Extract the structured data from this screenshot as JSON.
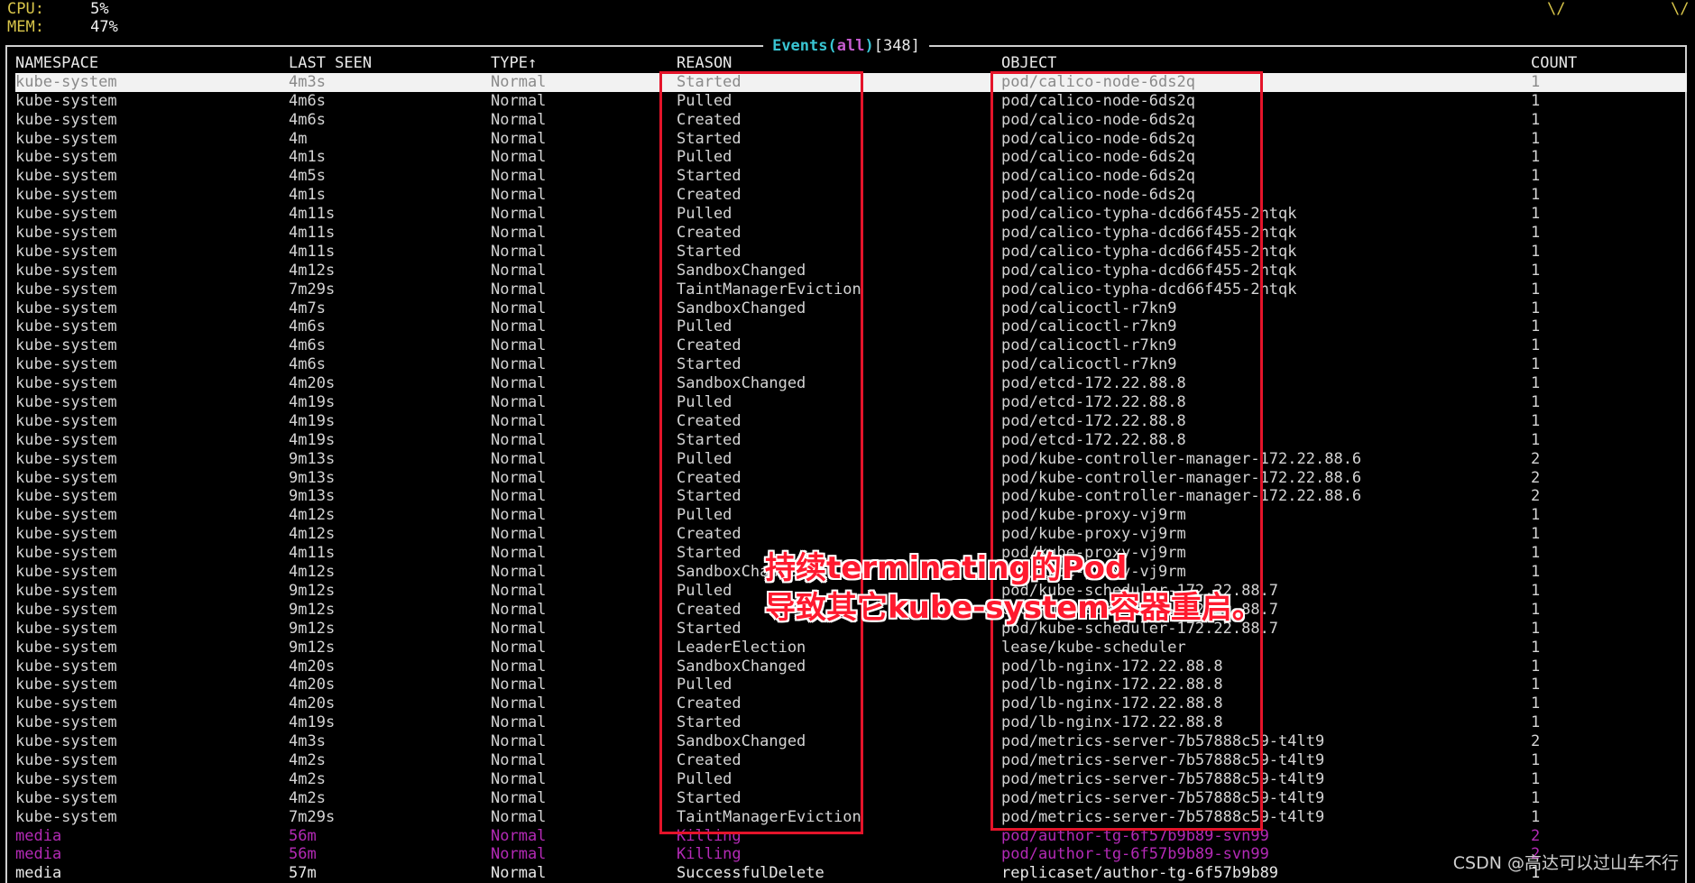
{
  "stats": {
    "cpu_label": "CPU:",
    "cpu_value": "5%",
    "mem_label": "MEM:",
    "mem_value": "47%",
    "right_markers": [
      "\\/",
      "\\/"
    ]
  },
  "panel": {
    "title_name": "Events",
    "title_paren_open": "(",
    "title_filter": "all",
    "title_paren_close": ")",
    "title_count": "[348]"
  },
  "columns": {
    "namespace": "NAMESPACE",
    "last_seen": "LAST SEEN",
    "type": "TYPE↑",
    "reason": "REASON",
    "object": "OBJECT",
    "count": "COUNT"
  },
  "rows": [
    {
      "ns": "kube-system",
      "ls": "4m3s",
      "type": "Normal",
      "reason": "Started",
      "object": "pod/calico-node-6ds2q",
      "count": "1"
    },
    {
      "ns": "kube-system",
      "ls": "4m6s",
      "type": "Normal",
      "reason": "Pulled",
      "object": "pod/calico-node-6ds2q",
      "count": "1"
    },
    {
      "ns": "kube-system",
      "ls": "4m6s",
      "type": "Normal",
      "reason": "Created",
      "object": "pod/calico-node-6ds2q",
      "count": "1"
    },
    {
      "ns": "kube-system",
      "ls": "4m",
      "type": "Normal",
      "reason": "Started",
      "object": "pod/calico-node-6ds2q",
      "count": "1"
    },
    {
      "ns": "kube-system",
      "ls": "4m1s",
      "type": "Normal",
      "reason": "Pulled",
      "object": "pod/calico-node-6ds2q",
      "count": "1"
    },
    {
      "ns": "kube-system",
      "ls": "4m5s",
      "type": "Normal",
      "reason": "Started",
      "object": "pod/calico-node-6ds2q",
      "count": "1"
    },
    {
      "ns": "kube-system",
      "ls": "4m1s",
      "type": "Normal",
      "reason": "Created",
      "object": "pod/calico-node-6ds2q",
      "count": "1"
    },
    {
      "ns": "kube-system",
      "ls": "4m11s",
      "type": "Normal",
      "reason": "Pulled",
      "object": "pod/calico-typha-dcd66f455-2htqk",
      "count": "1"
    },
    {
      "ns": "kube-system",
      "ls": "4m11s",
      "type": "Normal",
      "reason": "Created",
      "object": "pod/calico-typha-dcd66f455-2htqk",
      "count": "1"
    },
    {
      "ns": "kube-system",
      "ls": "4m11s",
      "type": "Normal",
      "reason": "Started",
      "object": "pod/calico-typha-dcd66f455-2htqk",
      "count": "1"
    },
    {
      "ns": "kube-system",
      "ls": "4m12s",
      "type": "Normal",
      "reason": "SandboxChanged",
      "object": "pod/calico-typha-dcd66f455-2htqk",
      "count": "1"
    },
    {
      "ns": "kube-system",
      "ls": "7m29s",
      "type": "Normal",
      "reason": "TaintManagerEviction",
      "object": "pod/calico-typha-dcd66f455-2htqk",
      "count": "1"
    },
    {
      "ns": "kube-system",
      "ls": "4m7s",
      "type": "Normal",
      "reason": "SandboxChanged",
      "object": "pod/calicoctl-r7kn9",
      "count": "1"
    },
    {
      "ns": "kube-system",
      "ls": "4m6s",
      "type": "Normal",
      "reason": "Pulled",
      "object": "pod/calicoctl-r7kn9",
      "count": "1"
    },
    {
      "ns": "kube-system",
      "ls": "4m6s",
      "type": "Normal",
      "reason": "Created",
      "object": "pod/calicoctl-r7kn9",
      "count": "1"
    },
    {
      "ns": "kube-system",
      "ls": "4m6s",
      "type": "Normal",
      "reason": "Started",
      "object": "pod/calicoctl-r7kn9",
      "count": "1"
    },
    {
      "ns": "kube-system",
      "ls": "4m20s",
      "type": "Normal",
      "reason": "SandboxChanged",
      "object": "pod/etcd-172.22.88.8",
      "count": "1"
    },
    {
      "ns": "kube-system",
      "ls": "4m19s",
      "type": "Normal",
      "reason": "Pulled",
      "object": "pod/etcd-172.22.88.8",
      "count": "1"
    },
    {
      "ns": "kube-system",
      "ls": "4m19s",
      "type": "Normal",
      "reason": "Created",
      "object": "pod/etcd-172.22.88.8",
      "count": "1"
    },
    {
      "ns": "kube-system",
      "ls": "4m19s",
      "type": "Normal",
      "reason": "Started",
      "object": "pod/etcd-172.22.88.8",
      "count": "1"
    },
    {
      "ns": "kube-system",
      "ls": "9m13s",
      "type": "Normal",
      "reason": "Pulled",
      "object": "pod/kube-controller-manager-172.22.88.6",
      "count": "2"
    },
    {
      "ns": "kube-system",
      "ls": "9m13s",
      "type": "Normal",
      "reason": "Created",
      "object": "pod/kube-controller-manager-172.22.88.6",
      "count": "2"
    },
    {
      "ns": "kube-system",
      "ls": "9m13s",
      "type": "Normal",
      "reason": "Started",
      "object": "pod/kube-controller-manager-172.22.88.6",
      "count": "2"
    },
    {
      "ns": "kube-system",
      "ls": "4m12s",
      "type": "Normal",
      "reason": "Pulled",
      "object": "pod/kube-proxy-vj9rm",
      "count": "1"
    },
    {
      "ns": "kube-system",
      "ls": "4m12s",
      "type": "Normal",
      "reason": "Created",
      "object": "pod/kube-proxy-vj9rm",
      "count": "1"
    },
    {
      "ns": "kube-system",
      "ls": "4m11s",
      "type": "Normal",
      "reason": "Started",
      "object": "pod/kube-proxy-vj9rm",
      "count": "1"
    },
    {
      "ns": "kube-system",
      "ls": "4m12s",
      "type": "Normal",
      "reason": "SandboxChanged",
      "object": "pod/kube-proxy-vj9rm",
      "count": "1"
    },
    {
      "ns": "kube-system",
      "ls": "9m12s",
      "type": "Normal",
      "reason": "Pulled",
      "object": "pod/kube-scheduler-172.22.88.7",
      "count": "1"
    },
    {
      "ns": "kube-system",
      "ls": "9m12s",
      "type": "Normal",
      "reason": "Created",
      "object": "pod/kube-scheduler-172.22.88.7",
      "count": "1"
    },
    {
      "ns": "kube-system",
      "ls": "9m12s",
      "type": "Normal",
      "reason": "Started",
      "object": "pod/kube-scheduler-172.22.88.7",
      "count": "1"
    },
    {
      "ns": "kube-system",
      "ls": "9m12s",
      "type": "Normal",
      "reason": "LeaderElection",
      "object": "lease/kube-scheduler",
      "count": "1"
    },
    {
      "ns": "kube-system",
      "ls": "4m20s",
      "type": "Normal",
      "reason": "SandboxChanged",
      "object": "pod/lb-nginx-172.22.88.8",
      "count": "1"
    },
    {
      "ns": "kube-system",
      "ls": "4m20s",
      "type": "Normal",
      "reason": "Pulled",
      "object": "pod/lb-nginx-172.22.88.8",
      "count": "1"
    },
    {
      "ns": "kube-system",
      "ls": "4m20s",
      "type": "Normal",
      "reason": "Created",
      "object": "pod/lb-nginx-172.22.88.8",
      "count": "1"
    },
    {
      "ns": "kube-system",
      "ls": "4m19s",
      "type": "Normal",
      "reason": "Started",
      "object": "pod/lb-nginx-172.22.88.8",
      "count": "1"
    },
    {
      "ns": "kube-system",
      "ls": "4m3s",
      "type": "Normal",
      "reason": "SandboxChanged",
      "object": "pod/metrics-server-7b57888c59-t4lt9",
      "count": "2"
    },
    {
      "ns": "kube-system",
      "ls": "4m2s",
      "type": "Normal",
      "reason": "Created",
      "object": "pod/metrics-server-7b57888c59-t4lt9",
      "count": "1"
    },
    {
      "ns": "kube-system",
      "ls": "4m2s",
      "type": "Normal",
      "reason": "Pulled",
      "object": "pod/metrics-server-7b57888c59-t4lt9",
      "count": "1"
    },
    {
      "ns": "kube-system",
      "ls": "4m2s",
      "type": "Normal",
      "reason": "Started",
      "object": "pod/metrics-server-7b57888c59-t4lt9",
      "count": "1"
    },
    {
      "ns": "kube-system",
      "ls": "7m29s",
      "type": "Normal",
      "reason": "TaintManagerEviction",
      "object": "pod/metrics-server-7b57888c59-t4lt9",
      "count": "1"
    },
    {
      "ns": "media",
      "ls": "56m",
      "type": "Normal",
      "reason": "Killing",
      "object": "pod/author-tg-6f57b9b89-svn99",
      "count": "2"
    },
    {
      "ns": "media",
      "ls": "56m",
      "type": "Normal",
      "reason": "Killing",
      "object": "pod/author-tg-6f57b9b89-svn99",
      "count": "2"
    },
    {
      "ns": "media",
      "ls": "57m",
      "type": "Normal",
      "reason": "SuccessfulDelete",
      "object": "replicaset/author-tg-6f57b9b89",
      "count": "1"
    }
  ],
  "row_styles": {
    "selected_index": 0,
    "killing_indices": [
      40,
      41
    ],
    "plain_media_indices": [
      42
    ]
  },
  "annotation": {
    "line1": "持续terminating的Pod",
    "line2": "导致其它kube-system容器重启。"
  },
  "watermark": "CSDN @高达可以过山车不行",
  "colors": {
    "accent_cyan": "#39c5d3",
    "accent_magenta": "#c55ccf",
    "stat_yellow": "#d9c64a",
    "killing_purple": "#b42ab6",
    "highlight_red": "#e4142a"
  }
}
